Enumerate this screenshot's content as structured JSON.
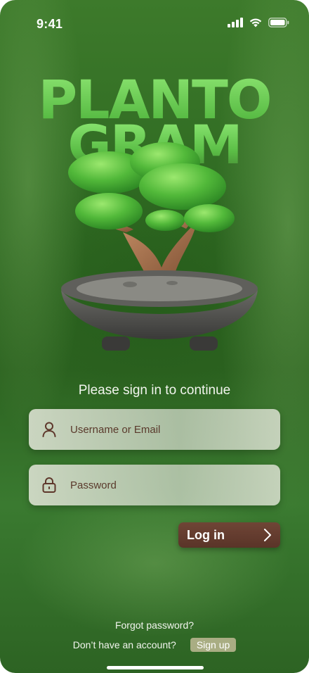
{
  "status_bar": {
    "time": "9:41"
  },
  "logo": {
    "line1": "PLANTO",
    "line2": "GRAM"
  },
  "subtitle": "Please sign in to continue",
  "form": {
    "username": {
      "placeholder": "Username or Email",
      "value": ""
    },
    "password": {
      "placeholder": "Password",
      "value": ""
    },
    "login_label": "Log in"
  },
  "footer": {
    "forgot": "Forgot password?",
    "signup_prompt": "Don’t have an account?",
    "signup_label": "Sign up"
  },
  "icons": {
    "signal": "signal-icon",
    "wifi": "wifi-icon",
    "battery": "battery-icon",
    "user": "user-icon",
    "lock": "lock-icon",
    "chevron": "chevron-right-icon"
  },
  "colors": {
    "accent_brown": "#5e372b",
    "logo_green": "#6fd35a",
    "signup_bg": "#a9ad83"
  }
}
